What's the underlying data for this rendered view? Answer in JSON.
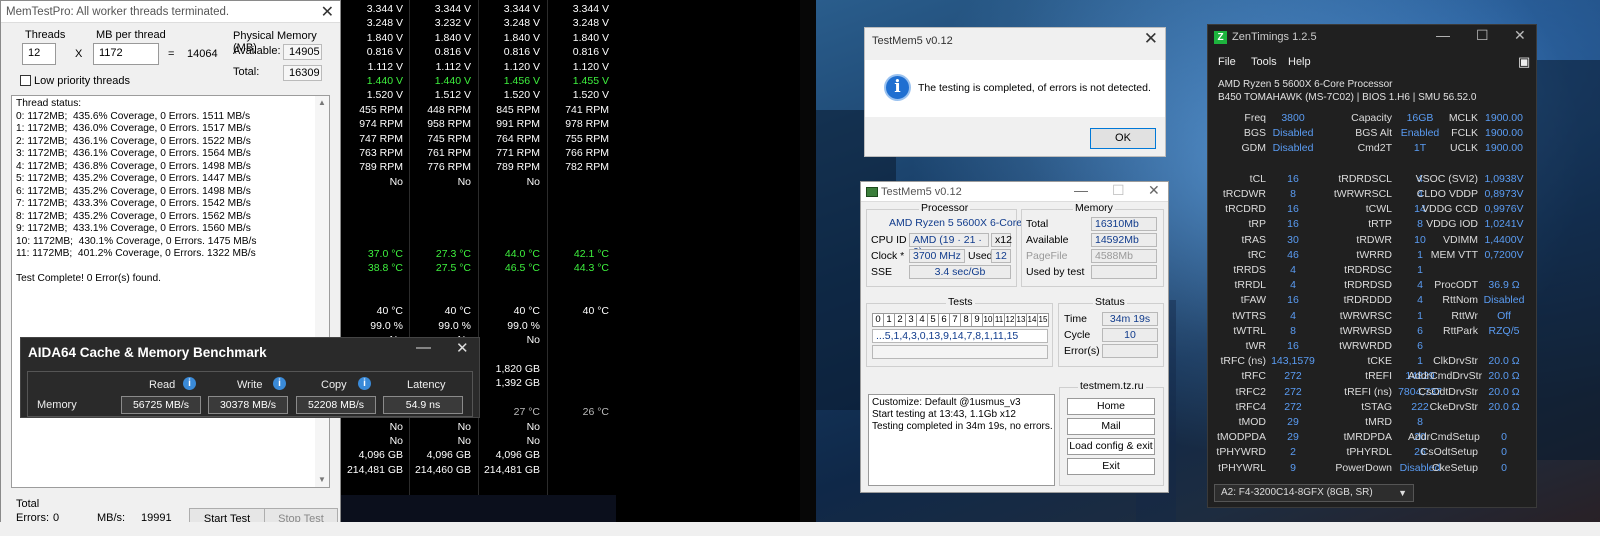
{
  "memtest": {
    "title": "MemTestPro: All worker threads terminated.",
    "threads_label": "Threads",
    "threads_value": "12",
    "x_symbol": "X",
    "mb_label": "MB per thread",
    "mb_value": "1172",
    "equals": "=",
    "total_value": "14064",
    "low_priority_label": "Low priority threads",
    "phys_mem_label": "Physical Memory (MB)",
    "available_label": "Available:",
    "available_value": "14905",
    "total_label": "Total:",
    "total_mem_value": "16309",
    "status_lines": [
      "Thread status:",
      "0: 1172MB;  435.6% Coverage, 0 Errors. 1511 MB/s",
      "1: 1172MB;  436.0% Coverage, 0 Errors. 1517 MB/s",
      "2: 1172MB;  436.1% Coverage, 0 Errors. 1522 MB/s",
      "3: 1172MB;  436.1% Coverage, 0 Errors. 1564 MB/s",
      "4: 1172MB;  436.8% Coverage, 0 Errors. 1498 MB/s",
      "5: 1172MB;  435.2% Coverage, 0 Errors. 1447 MB/s",
      "6: 1172MB;  435.2% Coverage, 0 Errors. 1498 MB/s",
      "7: 1172MB;  433.3% Coverage, 0 Errors. 1542 MB/s",
      "8: 1172MB;  435.2% Coverage, 0 Errors. 1562 MB/s",
      "9: 1172MB;  433.1% Coverage, 0 Errors. 1560 MB/s",
      "10: 1172MB;  430.1% Coverage, 0 Errors. 1475 MB/s",
      "11: 1172MB;  401.2% Coverage, 0 Errors. 1322 MB/s",
      "",
      "Test Complete! 0 Error(s) found."
    ],
    "footer_total_label": "Total",
    "errors_label": "Errors:",
    "errors_value": "0",
    "mbs_label": "MB/s:",
    "mbs_value": "19991",
    "start_test": "Start Test",
    "stop_test": "Stop Test"
  },
  "sensor_grid": {
    "rows": [
      [
        "3.344 V",
        "3.344 V",
        "3.344 V",
        "3.344 V"
      ],
      [
        "3.248 V",
        "3.232 V",
        "3.248 V",
        "3.248 V"
      ],
      [
        "1.840 V",
        "1.840 V",
        "1.840 V",
        "1.840 V"
      ],
      [
        "0.816 V",
        "0.816 V",
        "0.816 V",
        "0.816 V"
      ],
      [
        "1.112 V",
        "1.112 V",
        "1.120 V",
        "1.120 V"
      ],
      [
        "1.440 V",
        "1.440 V",
        "1.456 V",
        "1.455 V"
      ],
      [
        "1.520 V",
        "1.512 V",
        "1.520 V",
        "1.520 V"
      ],
      [
        "455 RPM",
        "448 RPM",
        "845 RPM",
        "741 RPM"
      ],
      [
        "974 RPM",
        "958 RPM",
        "991 RPM",
        "978 RPM"
      ],
      [
        "747 RPM",
        "745 RPM",
        "764 RPM",
        "755 RPM"
      ],
      [
        "763 RPM",
        "761 RPM",
        "771 RPM",
        "766 RPM"
      ],
      [
        "789 RPM",
        "776 RPM",
        "789 RPM",
        "782 RPM"
      ],
      [
        "No",
        "No",
        "No",
        ""
      ],
      [
        "",
        "",
        "",
        ""
      ],
      [
        "",
        "",
        "",
        ""
      ],
      [
        "",
        "",
        "",
        ""
      ],
      [
        "",
        "",
        "",
        ""
      ],
      [
        "37.0 °C",
        "27.3 °C",
        "44.0 °C",
        "42.1 °C"
      ],
      [
        "38.8 °C",
        "27.5 °C",
        "46.5 °C",
        "44.3 °C"
      ],
      [
        "",
        "",
        "",
        ""
      ],
      [
        "",
        "",
        "",
        ""
      ],
      [
        "40 °C",
        "40 °C",
        "40 °C",
        "40 °C"
      ],
      [
        "99.0 %",
        "99.0 %",
        "99.0 %",
        ""
      ],
      [
        "No",
        "No",
        "No",
        ""
      ],
      [
        "",
        "",
        "",
        ""
      ],
      [
        "",
        "",
        "1,820 GB",
        ""
      ],
      [
        "",
        "",
        "1,392 GB",
        ""
      ],
      [
        "",
        "",
        "",
        ""
      ],
      [
        "20 °C",
        "",
        "27 °C",
        "26 °C"
      ],
      [
        "No",
        "No",
        "No",
        ""
      ],
      [
        "No",
        "No",
        "No",
        ""
      ],
      [
        "4,096 GB",
        "4,096 GB",
        "4,096 GB",
        ""
      ],
      [
        "214,481 GB",
        "214,460 GB",
        "214,481 GB",
        ""
      ]
    ],
    "green_rows": [
      5,
      17,
      18
    ],
    "dim_rows": [
      28
    ]
  },
  "aida": {
    "title": "AIDA64 Cache & Memory Benchmark",
    "minimize": "—",
    "close": "✕",
    "col_read": "Read",
    "col_write": "Write",
    "col_copy": "Copy",
    "col_latency": "Latency",
    "row_memory": "Memory",
    "read": "56725 MB/s",
    "write": "30378 MB/s",
    "copy": "52208 MB/s",
    "latency": "54.9 ns"
  },
  "tm_popup": {
    "title": "TestMem5 v0.12",
    "close": "✕",
    "info_glyph": "i",
    "message": "The testing is completed, of errors is not detected.",
    "ok": "OK"
  },
  "tm_main": {
    "title": "TestMem5 v0.12",
    "minimize": "—",
    "maximize": "☐",
    "close": "✕",
    "processor_group": "Processor",
    "cpu_name": "AMD Ryzen 5 5600X 6-Core",
    "cpu_id_label": "CPU ID",
    "cpu_id_value": "AMD  (19 · 21 · 0)",
    "cpu_threads": "x12",
    "clock_label": "Clock *",
    "clock_value": "3700 MHz",
    "used_label": "Used",
    "used_value": "12",
    "sse_label": "SSE",
    "sse_value": "3.4 sec/Gb",
    "memory_group": "Memory",
    "total_label": "Total",
    "total_value": "16310Mb",
    "available_label": "Available",
    "available_value": "14592Mb",
    "pagefile_label": "PageFile",
    "pagefile_value": "4588Mb",
    "usedbytest_label": "Used by test",
    "usedbytest_value": "",
    "tests_group": "Tests",
    "test_numbers": [
      "0",
      "1",
      "2",
      "3",
      "4",
      "5",
      "6",
      "7",
      "8",
      "9",
      "10",
      "11",
      "12",
      "13",
      "14",
      "15"
    ],
    "test_sequence": "...5,1,4,3,0,13,9,14,7,8,1,11,15",
    "status_group": "Status",
    "time_label": "Time",
    "time_value": "34m 19s",
    "cycle_label": "Cycle",
    "cycle_value": "10",
    "errors_label": "Error(s)",
    "errors_value": "",
    "log_text": "Customize: Default @1usmus_v3\nStart testing at 13:43, 1.1Gb x12\nTesting completed in 34m 19s, no errors.",
    "site_group": "testmem.tz.ru",
    "btn_home": "Home",
    "btn_mail": "Mail",
    "btn_load": "Load config & exit",
    "btn_exit": "Exit"
  },
  "zen": {
    "icon_letter": "Z",
    "title": "ZenTimings 1.2.5",
    "minimize": "—",
    "maximize": "☐",
    "close": "✕",
    "menu_file": "File",
    "menu_tools": "Tools",
    "menu_help": "Help",
    "screenshot_icon": "▣",
    "cpu_line1": "AMD Ryzen 5 5600X 6-Core Processor",
    "cpu_line2": "B450 TOMAHAWK (MS-7C02) | BIOS 1.H6 | SMU 56.52.0",
    "rows": [
      [
        "Freq",
        "3800",
        "Capacity",
        "16GB",
        "MCLK",
        "1900.00"
      ],
      [
        "BGS",
        "Disabled",
        "BGS Alt",
        "Enabled",
        "FCLK",
        "1900.00"
      ],
      [
        "GDM",
        "Disabled",
        "Cmd2T",
        "1T",
        "UCLK",
        "1900.00"
      ],
      [
        "",
        "",
        "",
        "",
        "",
        ""
      ],
      [
        "tCL",
        "16",
        "tRDRDSCL",
        "4",
        "VSOC (SVI2)",
        "1,0938V"
      ],
      [
        "tRCDWR",
        "8",
        "tWRWRSCL",
        "4",
        "CLDO VDDP",
        "0,8973V"
      ],
      [
        "tRCDRD",
        "16",
        "tCWL",
        "14",
        "VDDG CCD",
        "0,9976V"
      ],
      [
        "tRP",
        "16",
        "tRTP",
        "8",
        "VDDG IOD",
        "1,0241V"
      ],
      [
        "tRAS",
        "30",
        "tRDWR",
        "10",
        "VDIMM",
        "1,4400V"
      ],
      [
        "tRC",
        "46",
        "tWRRD",
        "1",
        "MEM VTT",
        "0,7200V"
      ],
      [
        "tRRDS",
        "4",
        "tRDRDSC",
        "1",
        "",
        ""
      ],
      [
        "tRRDL",
        "4",
        "tRDRDSD",
        "4",
        "ProcODT",
        "36.9 Ω"
      ],
      [
        "tFAW",
        "16",
        "tRDRDDD",
        "4",
        "RttNom",
        "Disabled"
      ],
      [
        "tWTRS",
        "4",
        "tWRWRSC",
        "1",
        "RttWr",
        "Off"
      ],
      [
        "tWTRL",
        "8",
        "tWRWRSD",
        "6",
        "RttPark",
        "RZQ/5"
      ],
      [
        "tWR",
        "16",
        "tWRWRDD",
        "6",
        "",
        ""
      ],
      [
        "tRFC (ns)",
        "143,1579",
        "tCKE",
        "1",
        "ClkDrvStr",
        "20.0 Ω"
      ],
      [
        "tRFC",
        "272",
        "tREFI",
        "14829",
        "AddrCmdDrvStr",
        "20.0 Ω"
      ],
      [
        "tRFC2",
        "272",
        "tREFI (ns)",
        "7804,737",
        "CsOdtDrvStr",
        "20.0 Ω"
      ],
      [
        "tRFC4",
        "272",
        "tSTAG",
        "222",
        "CkeDrvStr",
        "20.0 Ω"
      ],
      [
        "tMOD",
        "29",
        "tMRD",
        "8",
        "",
        ""
      ],
      [
        "tMODPDA",
        "29",
        "tMRDPDA",
        "20",
        "AddrCmdSetup",
        "0"
      ],
      [
        "tPHYWRD",
        "2",
        "tPHYRDL",
        "26",
        "CsOdtSetup",
        "0"
      ],
      [
        "tPHYWRL",
        "9",
        "PowerDown",
        "Disabled",
        "CkeSetup",
        "0"
      ]
    ],
    "dimm_select": "A2: F4-3200C14-8GFX (8GB, SR)",
    "dropdown_arrow": "▼"
  },
  "colors": {
    "zen_value": "#5a9cf3",
    "sensor_green": "#3ef03e",
    "tm_field_text": "#103b8c"
  }
}
